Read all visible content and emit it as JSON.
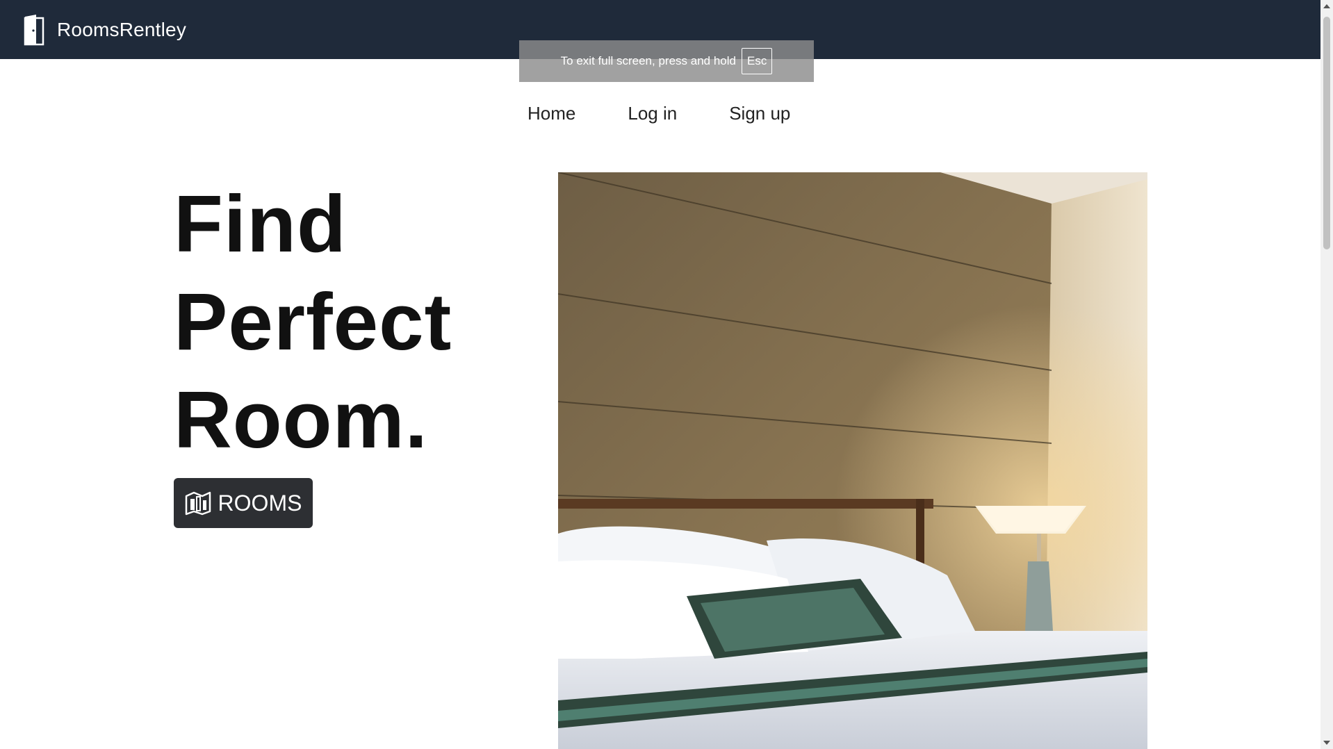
{
  "app": {
    "name": "RoomsRentley",
    "logo_icon": "door-icon"
  },
  "fullscreen_notice": {
    "text": "To exit full screen, press and hold",
    "key": "Esc"
  },
  "nav": {
    "items": [
      {
        "label": "Home"
      },
      {
        "label": "Log in"
      },
      {
        "label": "Sign up"
      }
    ]
  },
  "hero": {
    "title_lines": [
      "Find",
      "Perfect",
      "Room."
    ],
    "button": {
      "label": "ROOMS",
      "icon": "map-icon"
    },
    "image": {
      "subject": "hotel-bedroom-photo"
    }
  },
  "colors": {
    "topbar_bg": "#1f2a3a",
    "button_bg": "#2d2f33",
    "text_dark": "#111111"
  }
}
